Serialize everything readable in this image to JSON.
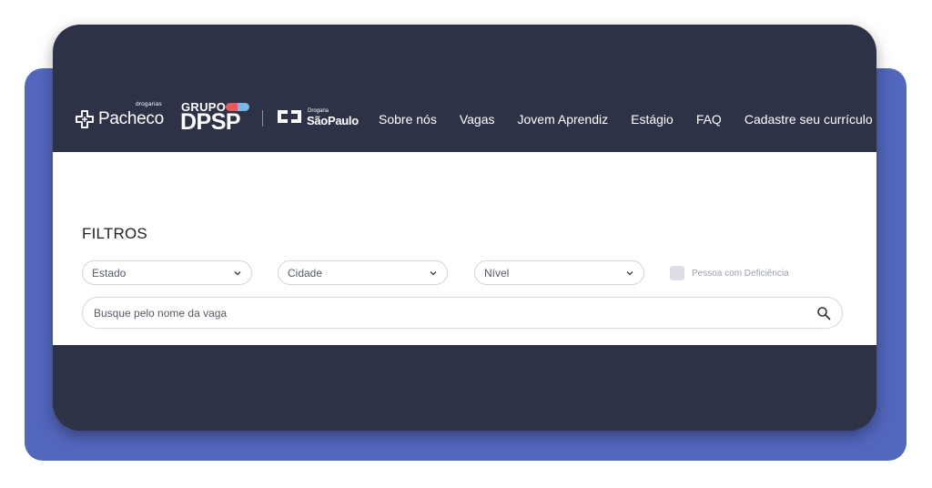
{
  "header": {
    "logos": {
      "pacheco": {
        "small": "drogarias",
        "name": "Pacheco"
      },
      "dpsp": {
        "top": "GRUPO",
        "main": "DPSP"
      },
      "drogaria_sp": {
        "small": "Drogaria",
        "name": "SãoPaulo"
      }
    },
    "nav": [
      {
        "label": "Sobre nós"
      },
      {
        "label": "Vagas"
      },
      {
        "label": "Jovem Aprendiz"
      },
      {
        "label": "Estágio"
      },
      {
        "label": "FAQ"
      },
      {
        "label": "Cadastre seu currículo"
      }
    ]
  },
  "filters": {
    "title": "FILTROS",
    "estado": {
      "selected": "Estado"
    },
    "cidade": {
      "selected": "Cidade"
    },
    "nivel": {
      "selected": "Nível"
    },
    "pcd": {
      "label": "Pessoa com Deficiência",
      "checked": false
    },
    "search": {
      "placeholder": "Busque pelo nome da vaga",
      "value": ""
    }
  },
  "colors": {
    "header_bg": "#2d3246",
    "backdrop": "#5366bd",
    "pill_red": "#e65a5f",
    "pill_blue": "#7ab8e8"
  },
  "icons": {
    "search": "search-icon",
    "chevron": "chevron-down-icon",
    "pacheco_logo": "cross-icon"
  }
}
